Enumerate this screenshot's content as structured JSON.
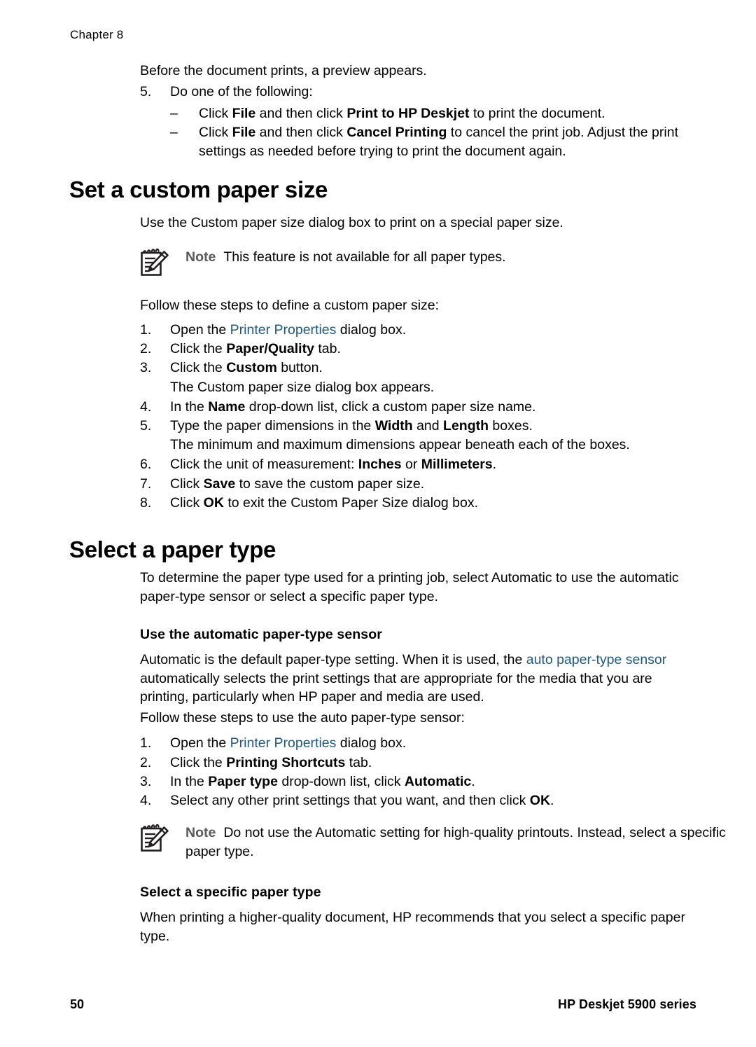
{
  "header": {
    "chapter": "Chapter 8"
  },
  "intro": {
    "preview_line": "Before the document prints, a preview appears.",
    "step5_num": "5.",
    "step5_text": "Do one of the following:",
    "dash": "–",
    "sub1": {
      "a": "Click ",
      "b1": "File",
      "c": " and then click ",
      "b2": "Print to HP Deskjet",
      "d": " to print the document."
    },
    "sub2": {
      "a": "Click ",
      "b1": "File",
      "c": " and then click ",
      "b2": "Cancel Printing",
      "d": " to cancel the print job. Adjust the print settings as needed before trying to print the document again."
    }
  },
  "section1": {
    "title": "Set a custom paper size",
    "lead": "Use the Custom paper size dialog box to print on a special paper size.",
    "note": {
      "label": "Note",
      "text": "This feature is not available for all paper types.",
      "icon": "note-pad-pencil-icon"
    },
    "follow": "Follow these steps to define a custom paper size:",
    "steps": [
      {
        "num": "1.",
        "pre": "Open the ",
        "link": "Printer Properties",
        "post": " dialog box."
      },
      {
        "num": "2.",
        "pre": "Click the ",
        "bold": "Paper/Quality",
        "post": " tab."
      },
      {
        "num": "3.",
        "pre": "Click the ",
        "bold": "Custom",
        "post": " button."
      },
      {
        "num": "4.",
        "pre": "In the ",
        "bold": "Name",
        "post": " drop-down list, click a custom paper size name."
      },
      {
        "num": "5.",
        "pre": "Type the paper dimensions in the ",
        "bold": "Width",
        "mid": " and ",
        "bold2": "Length",
        "post": " boxes."
      },
      {
        "num": "6.",
        "pre": "Click the unit of measurement: ",
        "bold": "Inches",
        "mid": " or ",
        "bold2": "Millimeters",
        "post": "."
      },
      {
        "num": "7.",
        "pre": "Click ",
        "bold": "Save",
        "post": " to save the custom paper size."
      },
      {
        "num": "8.",
        "pre": "Click ",
        "bold": "OK",
        "post": " to exit the Custom Paper Size dialog box."
      }
    ],
    "after_step3": "The Custom paper size dialog box appears.",
    "after_step5": "The minimum and maximum dimensions appear beneath each of the boxes."
  },
  "section2": {
    "title": "Select a paper type",
    "lead": "To determine the paper type used for a printing job, select Automatic to use the automatic paper-type sensor or select a specific paper type.",
    "sub1": {
      "heading": "Use the automatic paper-type sensor",
      "para_pre": "Automatic is the default paper-type setting. When it is used, the ",
      "para_link": "auto paper-type sensor",
      "para_post": " automatically selects the print settings that are appropriate for the media that you are printing, particularly when HP paper and media are used.",
      "follow": "Follow these steps to use the auto paper-type sensor:",
      "steps": [
        {
          "num": "1.",
          "pre": "Open the ",
          "link": "Printer Properties",
          "post": " dialog box."
        },
        {
          "num": "2.",
          "pre": "Click the ",
          "bold": "Printing Shortcuts",
          "post": " tab."
        },
        {
          "num": "3.",
          "pre": "In the ",
          "bold": "Paper type",
          "mid": " drop-down list, click ",
          "bold2": "Automatic",
          "post": "."
        },
        {
          "num": "4.",
          "pre": "Select any other print settings that you want, and then click ",
          "bold": "OK",
          "post": "."
        }
      ],
      "note": {
        "label": "Note",
        "text": "Do not use the Automatic setting for high-quality printouts. Instead, select a specific paper type.",
        "icon": "note-pad-pencil-icon"
      }
    },
    "sub2": {
      "heading": "Select a specific paper type",
      "para": "When printing a higher-quality document, HP recommends that you select a specific paper type."
    }
  },
  "footer": {
    "page_number": "50",
    "product": "HP Deskjet 5900 series"
  },
  "colors": {
    "link": "#20597F",
    "note_label": "#5a5a5a",
    "text": "#000000",
    "background": "#ffffff"
  }
}
